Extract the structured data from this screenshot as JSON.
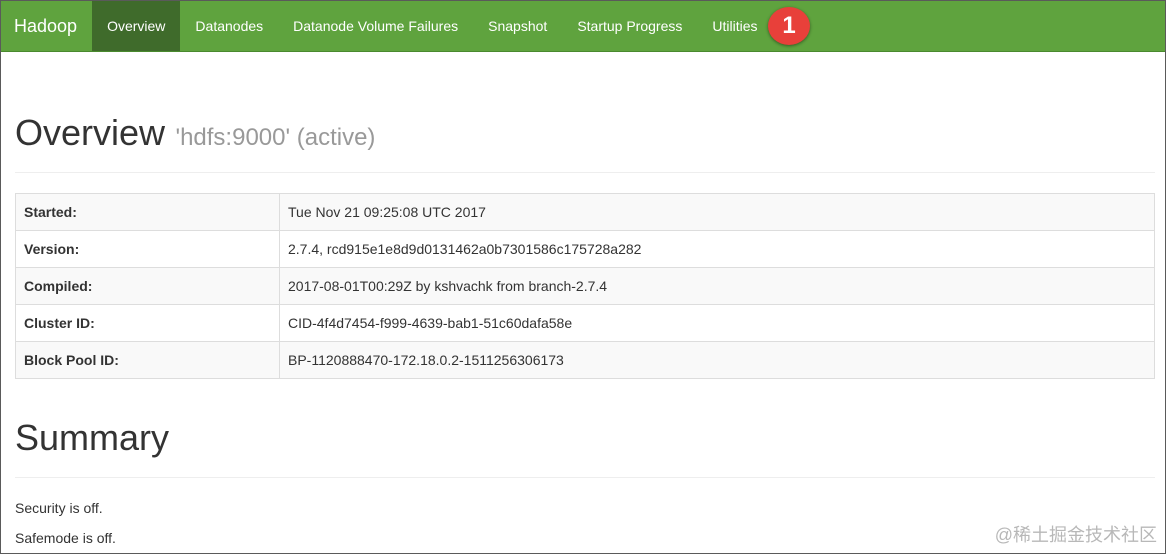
{
  "navbar": {
    "brand": "Hadoop",
    "items": [
      {
        "label": "Overview"
      },
      {
        "label": "Datanodes"
      },
      {
        "label": "Datanode Volume Failures"
      },
      {
        "label": "Snapshot"
      },
      {
        "label": "Startup Progress"
      },
      {
        "label": "Utilities"
      }
    ],
    "active_color": "#3f6b2b",
    "bar_color": "#5fa33e"
  },
  "annotation": {
    "badge": "1",
    "color": "#e8403a"
  },
  "overview": {
    "title": "Overview",
    "subtitle": "'hdfs:9000' (active)",
    "rows": [
      {
        "key": "Started:",
        "value": "Tue Nov 21 09:25:08 UTC 2017"
      },
      {
        "key": "Version:",
        "value": "2.7.4, rcd915e1e8d9d0131462a0b7301586c175728a282"
      },
      {
        "key": "Compiled:",
        "value": "2017-08-01T00:29Z by kshvachk from branch-2.7.4"
      },
      {
        "key": "Cluster ID:",
        "value": "CID-4f4d7454-f999-4639-bab1-51c60dafa58e"
      },
      {
        "key": "Block Pool ID:",
        "value": "BP-1120888470-172.18.0.2-1511256306173"
      }
    ]
  },
  "summary": {
    "title": "Summary",
    "security": "Security is off.",
    "safemode": "Safemode is off."
  },
  "watermark": "@稀土掘金技术社区"
}
